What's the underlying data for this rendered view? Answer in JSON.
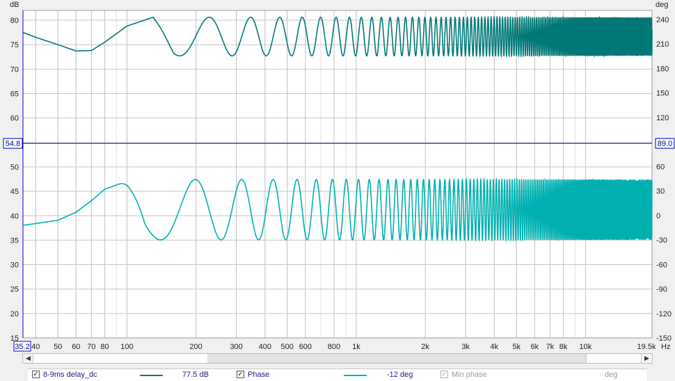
{
  "chart_data": {
    "type": "line",
    "x_scale": "log",
    "xunit": "Hz",
    "xlim": [
      35.2,
      19500
    ],
    "x_ticks": [
      "40",
      "50",
      "60",
      "70",
      "80",
      "100",
      "200",
      "300",
      "400",
      "500",
      "600",
      "800",
      "1k",
      "2k",
      "3k",
      "4k",
      "5k",
      "6k",
      "7k",
      "8k",
      "10k"
    ],
    "x_tick_values": [
      40,
      50,
      60,
      70,
      80,
      100,
      200,
      300,
      400,
      500,
      600,
      800,
      1000,
      2000,
      3000,
      4000,
      5000,
      6000,
      7000,
      8000,
      10000
    ],
    "x_start_label": "35.2",
    "x_end_label": "19.5k",
    "y_left": {
      "label": "dB",
      "ylim": [
        15,
        82
      ],
      "ticks": [
        80,
        75,
        70,
        65,
        60,
        55,
        50,
        45,
        40,
        35,
        30,
        25,
        20,
        15
      ]
    },
    "y_right": {
      "label": "deg",
      "ylim": [
        -150,
        251
      ],
      "ticks": [
        240,
        210,
        180,
        150,
        120,
        90,
        60,
        30,
        0,
        -30,
        -60,
        -90,
        -120,
        -150
      ]
    },
    "cursor": {
      "left_label": "54.8",
      "right_label": "89.0"
    },
    "grid": true,
    "series": [
      {
        "name": "8-9ms delay_dc",
        "axis": "left",
        "color": "#007878",
        "description_points": {
          "x": [
            35.2,
            40,
            50,
            60,
            70,
            80,
            100,
            130,
            200,
            250,
            300,
            400,
            500,
            19500
          ],
          "y": [
            77.5,
            76.5,
            75,
            73.7,
            73.8,
            75.5,
            78.8,
            80.6,
            73,
            80.6,
            73,
            80.6,
            73,
            80.6
          ]
        },
        "comb_delay_ms": 8.5,
        "max_db": 80.6,
        "min_db": 72.7
      },
      {
        "name": "Phase",
        "axis": "right",
        "color": "#00b0b0",
        "description_points": {
          "x": [
            35.2,
            40,
            50,
            60,
            70,
            80,
            100,
            150,
            200,
            250,
            300,
            400,
            19500
          ],
          "y": [
            -12,
            -10,
            -6,
            4,
            18,
            32,
            42,
            28,
            -2,
            40,
            -10,
            42,
            -30
          ]
        },
        "max_deg": 44,
        "min_deg": -30
      }
    ],
    "legend": [
      {
        "label": "8-9ms delay_dc",
        "checked": true,
        "value": "77.5 dB",
        "color": "#007878"
      },
      {
        "label": "Phase",
        "checked": true,
        "value": "-12 deg",
        "color": "#00b0b0"
      },
      {
        "label": "Min phase",
        "checked": true,
        "disabled": true,
        "value": "deg"
      }
    ]
  },
  "scrollbar": {
    "left_arrow": "◀",
    "right_arrow": "▶"
  }
}
